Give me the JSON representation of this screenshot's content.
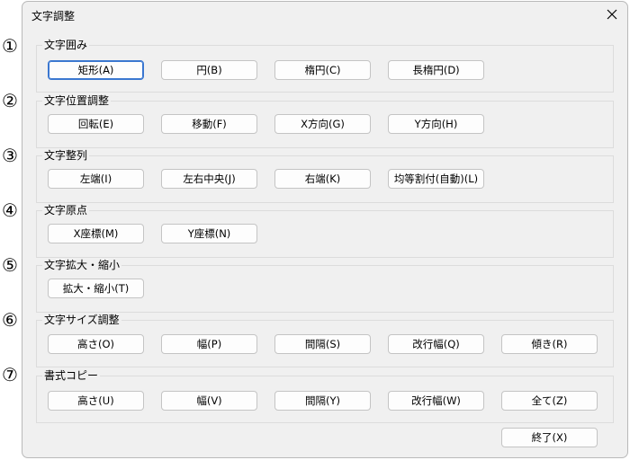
{
  "markers": [
    "①",
    "②",
    "③",
    "④",
    "⑤",
    "⑥",
    "⑦"
  ],
  "dialog": {
    "title": "文字調整"
  },
  "groups": [
    {
      "label": "文字囲み",
      "buttons": [
        "矩形(A)",
        "円(B)",
        "楕円(C)",
        "長楕円(D)"
      ]
    },
    {
      "label": "文字位置調整",
      "buttons": [
        "回転(E)",
        "移動(F)",
        "X方向(G)",
        "Y方向(H)"
      ]
    },
    {
      "label": "文字整列",
      "buttons": [
        "左端(I)",
        "左右中央(J)",
        "右端(K)",
        "均等割付(自動)(L)"
      ]
    },
    {
      "label": "文字原点",
      "buttons": [
        "X座標(M)",
        "Y座標(N)"
      ]
    },
    {
      "label": "文字拡大・縮小",
      "buttons": [
        "拡大・縮小(T)"
      ]
    },
    {
      "label": "文字サイズ調整",
      "buttons": [
        "高さ(O)",
        "幅(P)",
        "間隔(S)",
        "改行幅(Q)",
        "傾き(R)"
      ]
    },
    {
      "label": "書式コピー",
      "buttons": [
        "高さ(U)",
        "幅(V)",
        "間隔(Y)",
        "改行幅(W)",
        "全て(Z)"
      ]
    }
  ],
  "footer": {
    "exit_label": "終了(X)"
  }
}
